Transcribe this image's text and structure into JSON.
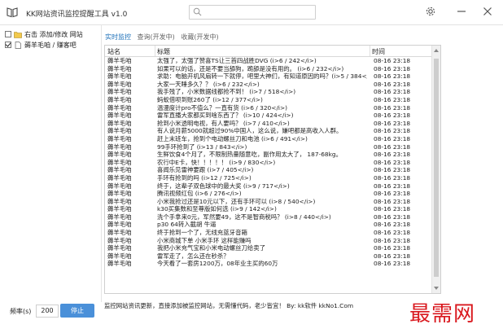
{
  "app": {
    "title": "KK网站资讯监控提醒工具 v1.0",
    "accent_color": "#1b6fb8",
    "button_color": "#4a90d9",
    "watermark_color": "#d9181e"
  },
  "tree": [
    {
      "label": "右击 添加/修改 网站",
      "checked": false,
      "icon": "folder-icon"
    },
    {
      "label": "薅羊毛咱 / 赚客吧",
      "checked": true,
      "icon": "document-icon"
    }
  ],
  "tabs": [
    {
      "label": "实时监控",
      "active": true
    },
    {
      "label": "查询(开发中)",
      "active": false
    },
    {
      "label": "收藏(开发中)",
      "active": false
    }
  ],
  "table": {
    "columns": [
      "站名",
      "标题",
      "时间"
    ],
    "rows": [
      [
        "薅羊毛咱",
        "太强了，太强了赞喜TS让三首四战胜DVG  (i>6 / 242</i>)",
        "08-16 23:18"
      ],
      [
        "薅羊毛咱",
        "如果可以的话，还是不要当舔狗，跪舔是没有用的。 (i>6 / 232</i>)",
        "08-16 23:18"
      ],
      [
        "薅羊毛咱",
        "求助：电脑开机风扇转一下就停，吧里大神们，有知道原因的吗？(i>5 / 384</i>)",
        "08-16 23:18"
      ],
      [
        "薅羊毛咱",
        "大家一天睡多久？？ (i>6 / 232</i>)",
        "08-16 23:18"
      ],
      [
        "薅羊毛咱",
        "我手残了，小米数据线都抢不到！ (i>7 / 518</i>)",
        "08-16 23:18"
      ],
      [
        "薅羊毛咱",
        "蚂蚁借呗到账260了 (i>12 / 377</i>)",
        "08-16 23:18"
      ],
      [
        "薅羊毛咱",
        "温漫度计pro不值么？一直有货 (i>6 / 320</i>)",
        "08-16 23:18"
      ],
      [
        "薅羊毛咱",
        "雷军直播大家都买到啥东西了？ (i>10 / 424</i>)",
        "08-16 23:18"
      ],
      [
        "薅羊毛咱",
        "抢到小米透明电视，有人要吗？ (i>7 / 410</i>)",
        "08-16 23:18"
      ],
      [
        "薅羊毛咱",
        "有人说月薪5000就超过90%中国人，这么说，嫌吧都是高收入人群。",
        "08-16 23:18"
      ],
      [
        "薅羊毛咱",
        "赶上末班车，抢到个电动螺丝刀和电池 (i>6 / 491</i>)",
        "08-16 23:18"
      ],
      [
        "薅羊毛咱",
        "99手环抢到了 (i>13 / 843</i>)",
        "08-16 23:18"
      ],
      [
        "薅羊毛咱",
        "生鲜饮食4个月了，不限制热量随意吃，副作用太大了， 187-68kg。",
        "08-16 23:18"
      ],
      [
        "薅羊毛咱",
        "农行中E卡，快！！！！！ (i>9 / 830</i>)",
        "08-16 23:18"
      ],
      [
        "薅羊毛咱",
        "喜闻乐见雷神要跟 (i>7 / 405</i>)",
        "08-16 23:18"
      ],
      [
        "薅羊毛咱",
        "手环有抢到的吗 (i>12 / 725</i>)",
        "08-16 23:18"
      ],
      [
        "薅羊毛咱",
        "终于，这辈子双色球中的最大奖 (i>9 / 717</i>)",
        "08-16 23:18"
      ],
      [
        "薅羊毛咱",
        "腾讯视频红包 (i>6 / 276</i>)",
        "08-16 23:18"
      ],
      [
        "薅羊毛咱",
        "小米我抢过还是10元以下，还有手环可以 (i>8 / 540</i>)",
        "08-16 23:18"
      ],
      [
        "薅羊毛咱",
        "k30买集数和至尊版如何选 (i>9 / 142</i>)",
        "08-16 23:18"
      ],
      [
        "薅羊毛咱",
        "洗个手拿来0元，军然要49，这不是智商税吗？ (i>8 / 440</i>)",
        "08-16 23:18"
      ],
      [
        "薅羊毛咱",
        "p30 64转入截胡 牛逼",
        "08-16 23:18"
      ],
      [
        "薅羊毛咱",
        "终于抢到一个了，无线充蓝牙音箱",
        "08-16 23:18"
      ],
      [
        "薅羊毛咱",
        "小米商城下单 小米手环 这样能赚吗",
        "08-16 23:18"
      ],
      [
        "薅羊毛咱",
        "我把小米充气宝和小米电动螺丝刀给卖了",
        "08-16 23:18"
      ],
      [
        "薅羊毛咱",
        "雷军走了，怎么还在秒杀？",
        "08-16 23:18"
      ],
      [
        "薅羊毛咱",
        "今天看了一套房1200万，08年业主买的60万",
        "08-16 23:18"
      ]
    ]
  },
  "bottom": {
    "freq_label": "频率(s)",
    "freq_value": "200",
    "stop_label": "停止",
    "status_text": "监控网站资讯更新，直接添加被监控网站，无需懂代码，老少皆宜！  By: kk软件 kkNo1.Com",
    "watermark": "最需网"
  }
}
